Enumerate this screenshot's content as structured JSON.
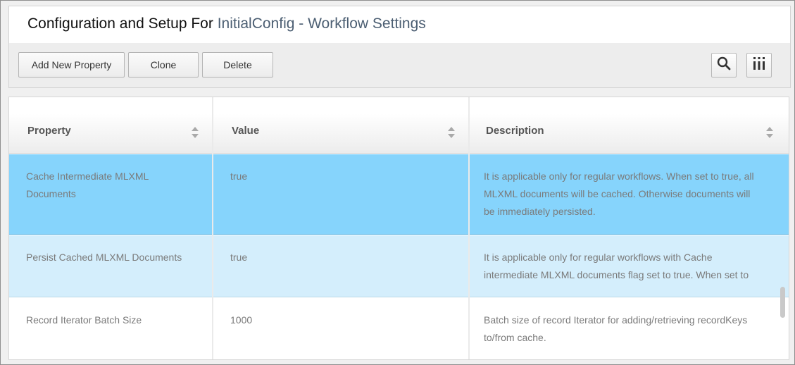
{
  "header": {
    "title_prefix": "Configuration and Setup For",
    "title_config": "InitialConfig",
    "title_sep": " - ",
    "title_section": "Workflow Settings"
  },
  "toolbar": {
    "add_label": "Add New Property",
    "clone_label": "Clone",
    "delete_label": "Delete",
    "search_icon": "search-icon",
    "columns_icon": "columns-icon"
  },
  "table": {
    "columns": [
      "Property",
      "Value",
      "Description"
    ],
    "rows": [
      {
        "property": [
          "Cache Intermediate MLXML",
          "Documents"
        ],
        "value": "true",
        "description": [
          "It is applicable only for regular workflows. When set to true, all",
          "MLXML documents will be cached. Otherwise documents will",
          "be immediately persisted."
        ],
        "state": "selected"
      },
      {
        "property": [
          "Persist Cached MLXML Documents"
        ],
        "value": "true",
        "description": [
          "It is applicable only for regular workflows with Cache",
          "intermediate MLXML documents flag set to true. When set to"
        ],
        "state": "hover"
      },
      {
        "property": [
          "Record Iterator Batch Size"
        ],
        "value": "1000",
        "description": [
          "Batch size of record Iterator for adding/retrieving recordKeys",
          "to/from cache."
        ],
        "state": "normal"
      }
    ]
  },
  "colors": {
    "accent_title": "#4b5e72",
    "selected_row": "#86d4fc",
    "hover_row": "#d4eefc"
  }
}
